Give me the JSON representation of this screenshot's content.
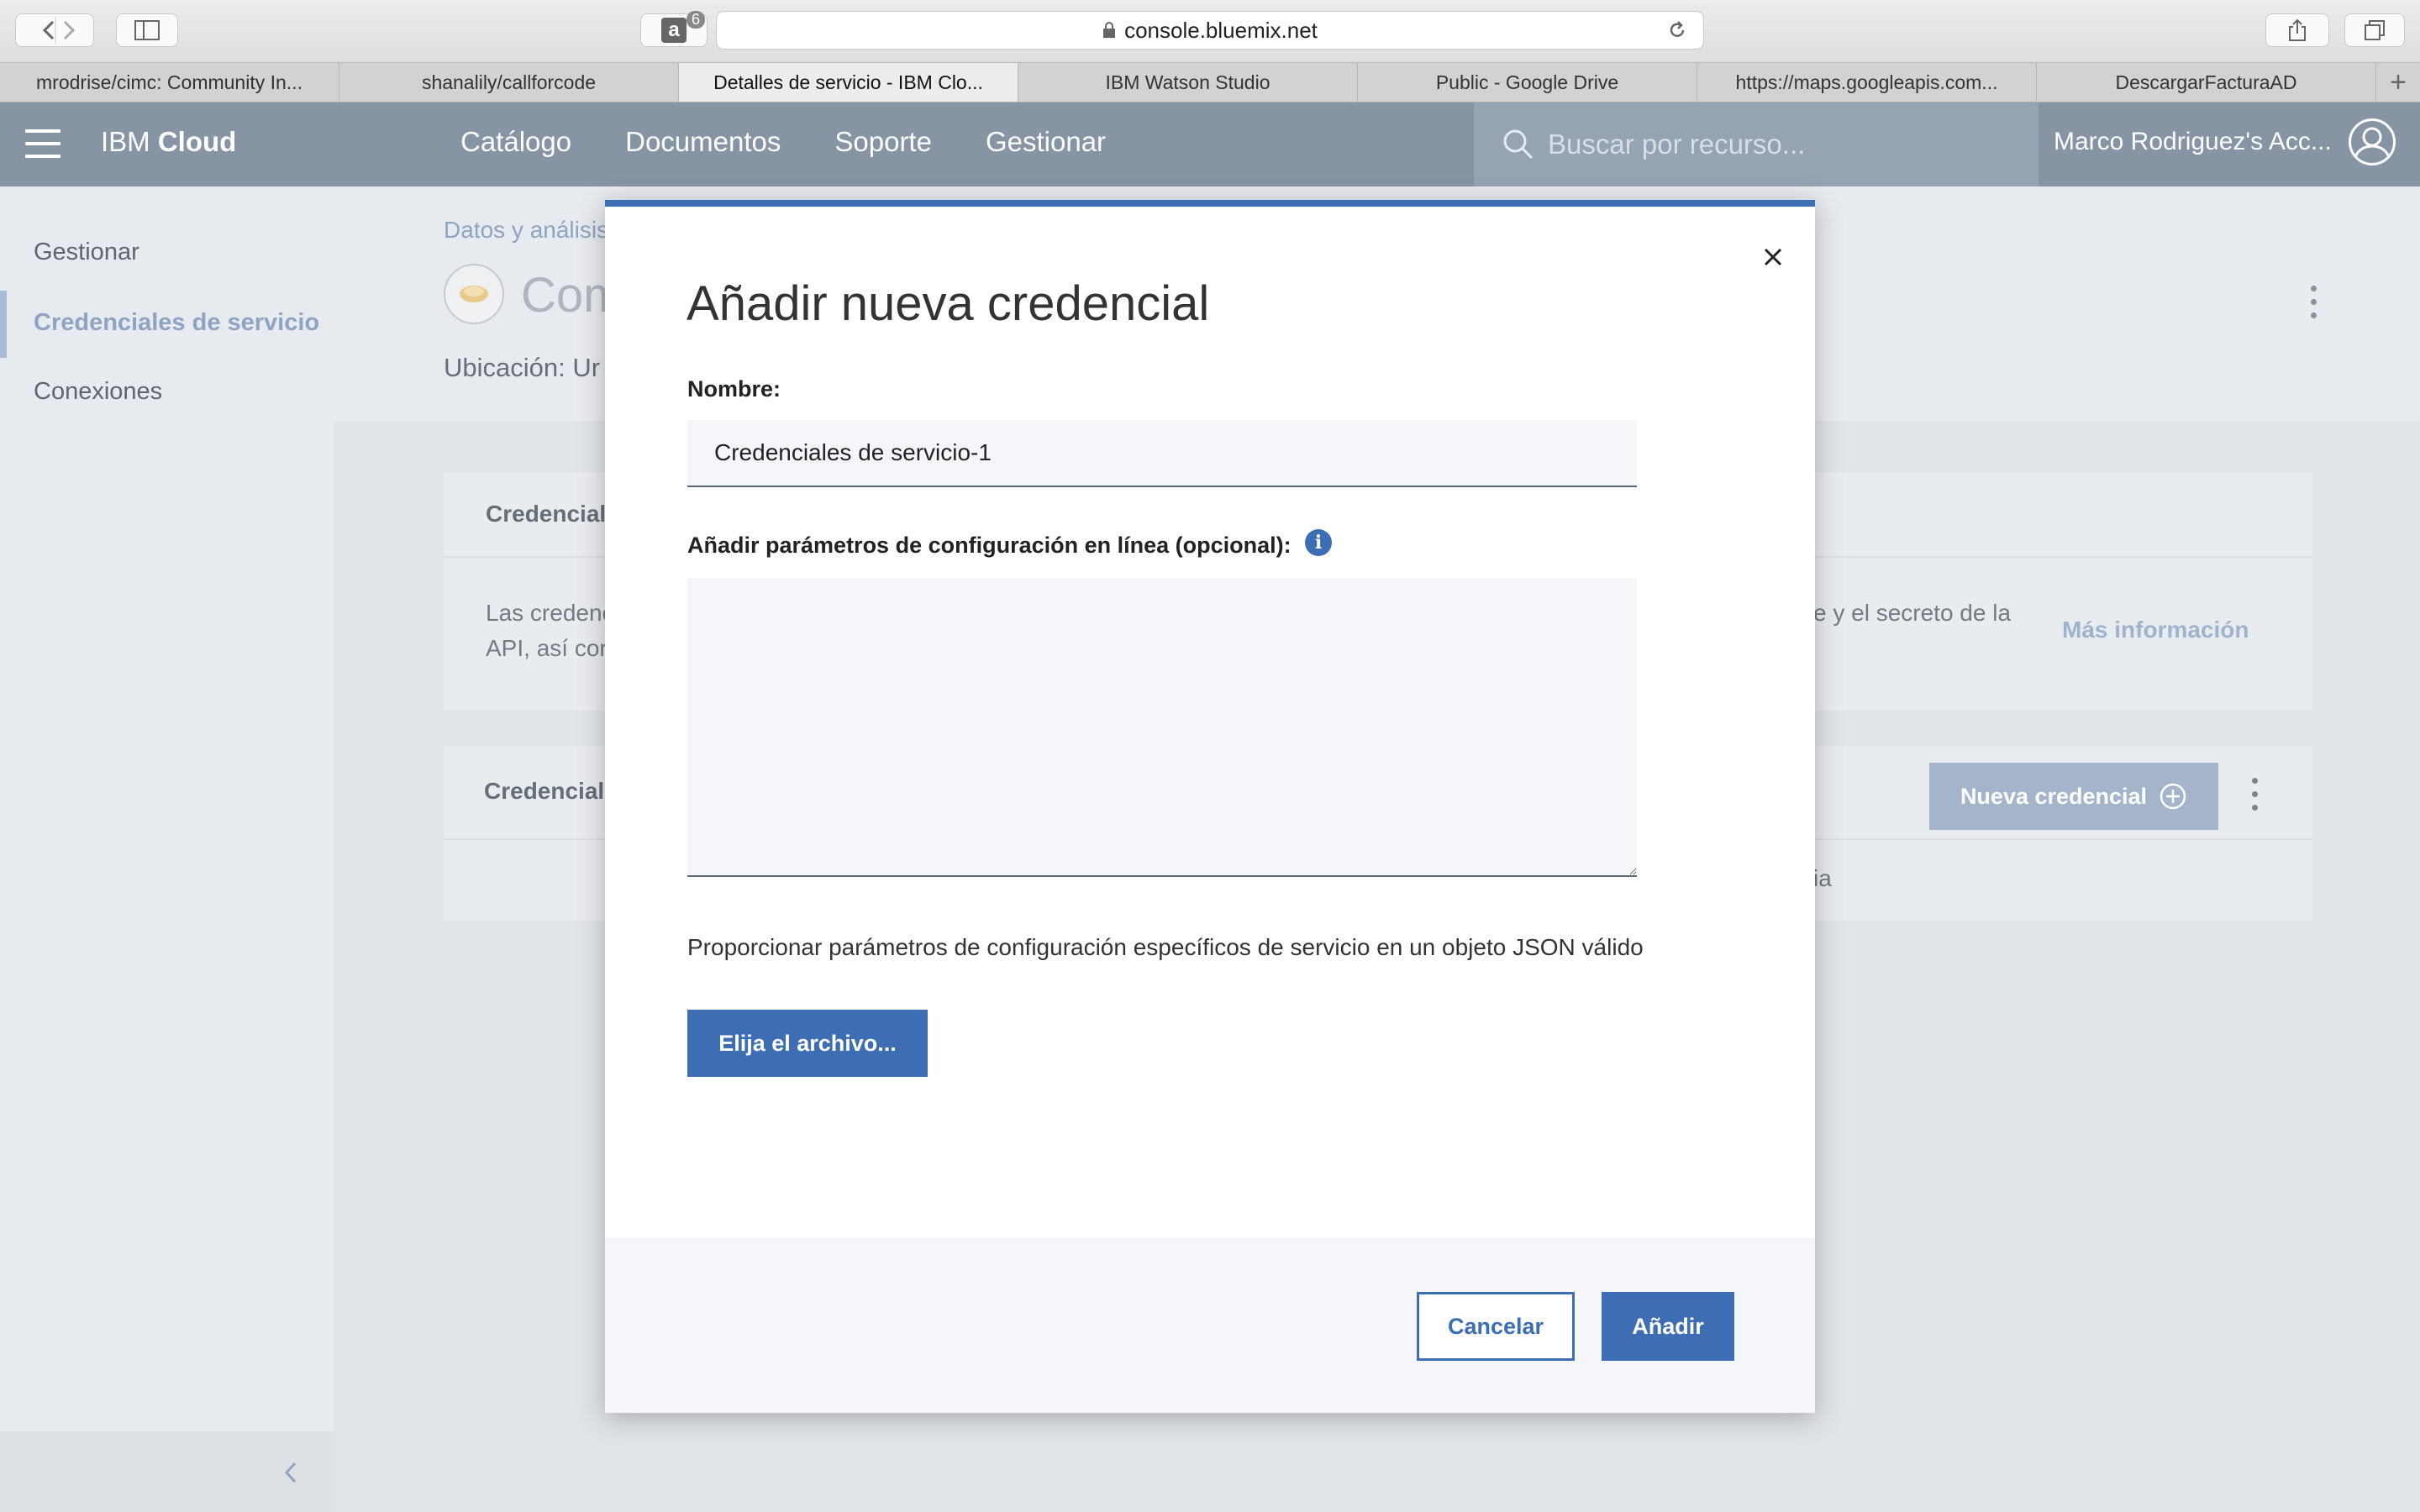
{
  "browser": {
    "url": "console.bluemix.net",
    "reading_badge": "6",
    "tabs": [
      {
        "label": "mrodrise/cimc: Community In...",
        "active": false
      },
      {
        "label": "shanalily/callforcode",
        "active": false
      },
      {
        "label": "Detalles de servicio - IBM Clo...",
        "active": true
      },
      {
        "label": "IBM Watson Studio",
        "active": false
      },
      {
        "label": "Public - Google Drive",
        "active": false
      },
      {
        "label": "https://maps.googleapis.com...",
        "active": false
      },
      {
        "label": "DescargarFacturaAD",
        "active": false
      }
    ],
    "new_tab": "+"
  },
  "header": {
    "brand_regular": "IBM ",
    "brand_bold": "Cloud",
    "nav": [
      "Catálogo",
      "Documentos",
      "Soporte",
      "Gestionar"
    ],
    "search_placeholder": "Buscar por recurso...",
    "account": "Marco Rodriguez's Acc..."
  },
  "sidebar": {
    "items": [
      "Gestionar",
      "Credenciales de servicio",
      "Conexiones"
    ],
    "active_index": 1
  },
  "page": {
    "breadcrumb": "Datos y análisis",
    "title_partial": "Com",
    "location_label": "Ubicación: Ur",
    "card1_title": "Credenciale",
    "card1_text_left": "Las credenc",
    "card1_text_left2": "API, así cor",
    "card1_text_right": "e y el secreto de la",
    "more_info": "Más información",
    "card2_title": "Credenciale",
    "new_credential_button": "Nueva credencial",
    "row_fragment": "ia"
  },
  "modal": {
    "title": "Añadir nueva credencial",
    "name_label": "Nombre:",
    "name_value": "Credenciales de servicio-1",
    "params_label": "Añadir parámetros de configuración en línea (opcional):",
    "info_glyph": "i",
    "params_value": "",
    "hint": "Proporcionar parámetros de configuración específicos de servicio en un objeto JSON válido",
    "choose_file": "Elija el archivo...",
    "cancel": "Cancelar",
    "add": "Añadir",
    "close_icon": "close-icon"
  },
  "colors": {
    "accent": "#3d6eb4",
    "header": "#8694a4"
  }
}
